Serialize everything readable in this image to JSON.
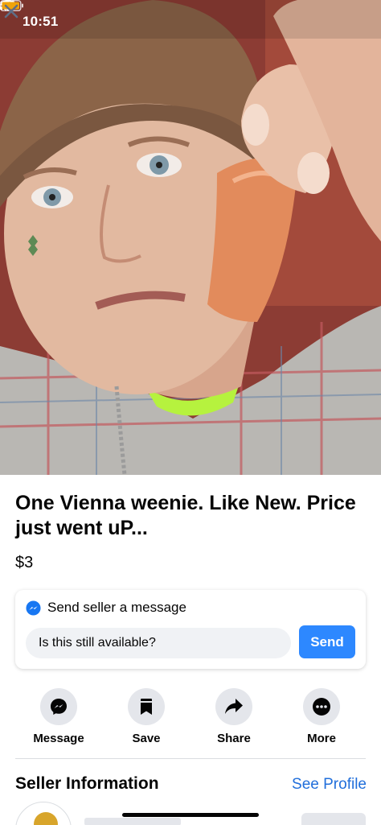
{
  "status_bar": {
    "time": "10:51"
  },
  "listing": {
    "title": "One Vienna weenie. Like New. Price just went uP...",
    "price": "$3"
  },
  "message_card": {
    "header": "Send seller a message",
    "input_value": "Is this still available?",
    "send_label": "Send"
  },
  "actions": [
    {
      "label": "Message",
      "icon": "messenger-icon"
    },
    {
      "label": "Save",
      "icon": "bookmark-icon"
    },
    {
      "label": "Share",
      "icon": "share-arrow-icon"
    },
    {
      "label": "More",
      "icon": "more-dots-icon"
    }
  ],
  "seller": {
    "heading": "Seller Information",
    "see_profile": "See Profile"
  },
  "colors": {
    "accent": "#2d88ff",
    "link": "#216fdb",
    "action_bg": "#e4e6eb"
  }
}
